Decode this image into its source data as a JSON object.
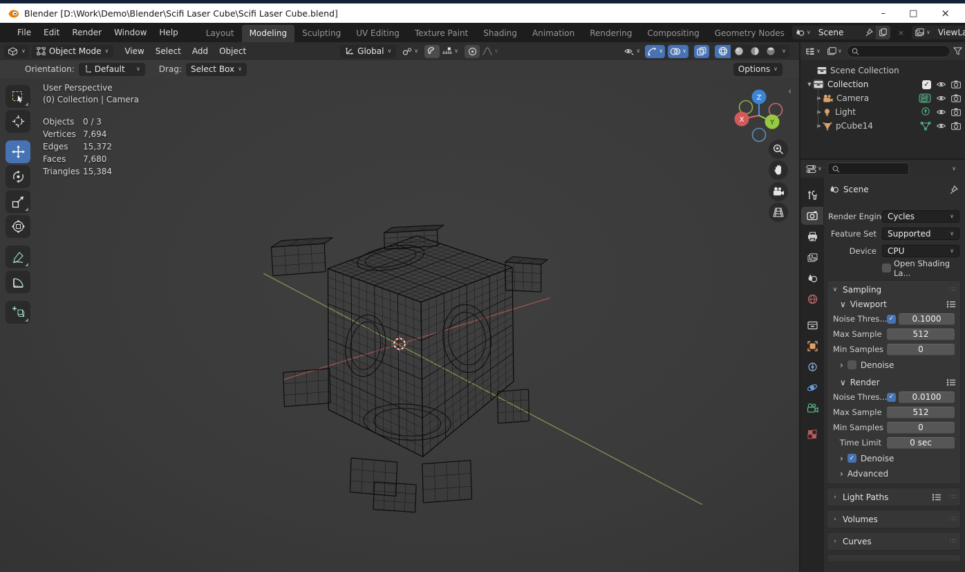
{
  "titlebar": {
    "title": "Blender [D:\\Work\\Demo\\Blender\\Scifi Laser Cube\\Scifi Laser Cube.blend]"
  },
  "window_controls": {
    "minimize": "–",
    "maximize": "□",
    "close": "×"
  },
  "glyphs": {
    "chevron_down": "∨",
    "chevron_right": "›",
    "tri_down": "▼",
    "tri_right": "▶",
    "check": "✓",
    "grip": "∷∷",
    "collapse_left": "‹"
  },
  "topbar": {
    "menus": [
      "File",
      "Edit",
      "Render",
      "Window",
      "Help"
    ],
    "tabs": [
      "Layout",
      "Modeling",
      "Sculpting",
      "UV Editing",
      "Texture Paint",
      "Shading",
      "Animation",
      "Rendering",
      "Compositing",
      "Geometry Nodes"
    ],
    "scene_selector": {
      "value": "Scene"
    },
    "view_layer_selector": {
      "value": "ViewLayer"
    }
  },
  "viewport_header": {
    "mode": "Object Mode",
    "menus": [
      "View",
      "Select",
      "Add",
      "Object"
    ],
    "orientation": "Global"
  },
  "tool_settings": {
    "orientation_label": "Orientation:",
    "orientation_value": "Default",
    "drag_label": "Drag:",
    "drag_value": "Select Box",
    "options_label": "Options"
  },
  "viewport": {
    "view_label": "User Perspective",
    "context_label": "(0) Collection | Camera",
    "stats": [
      {
        "label": "Objects",
        "value": "0 / 3"
      },
      {
        "label": "Vertices",
        "value": "7,694"
      },
      {
        "label": "Edges",
        "value": "15,372"
      },
      {
        "label": "Faces",
        "value": "7,680"
      },
      {
        "label": "Triangles",
        "value": "15,384"
      }
    ],
    "gizmo_axes": {
      "x": "X",
      "y": "Y",
      "z": "Z"
    }
  },
  "outliner": {
    "root": "Scene Collection",
    "collection": "Collection",
    "items": [
      {
        "name": "Camera"
      },
      {
        "name": "Light"
      },
      {
        "name": "pCube14"
      }
    ]
  },
  "properties": {
    "breadcrumb": "Scene",
    "render_engine": {
      "label": "Render Engine",
      "value": "Cycles"
    },
    "feature_set": {
      "label": "Feature Set",
      "value": "Supported"
    },
    "device": {
      "label": "Device",
      "value": "CPU"
    },
    "open_shading": "Open Shading La...",
    "sampling": {
      "title": "Sampling",
      "viewport": {
        "title": "Viewport",
        "noise_label": "Noise Thres...",
        "noise_value": "0.1000",
        "max_label": "Max Sample",
        "max_value": "512",
        "min_label": "Min Samples",
        "min_value": "0",
        "denoise_label": "Denoise"
      },
      "render": {
        "title": "Render",
        "noise_label": "Noise Thres...",
        "noise_value": "0.0100",
        "max_label": "Max Sample",
        "max_value": "512",
        "min_label": "Min Samples",
        "min_value": "0",
        "time_label": "Time Limit",
        "time_value": "0 sec",
        "denoise_label": "Denoise",
        "advanced_label": "Advanced"
      }
    },
    "collapsed_panels": [
      "Light Paths",
      "Volumes",
      "Curves"
    ]
  },
  "colors": {
    "accent": "#4772b3",
    "axis_x": "#b85b5b",
    "axis_y": "#8aa657",
    "axis_z": "#4a90d9",
    "wire": "#0c0c0c"
  }
}
